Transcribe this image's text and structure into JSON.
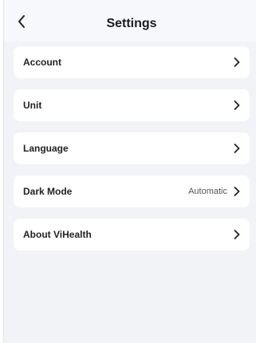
{
  "header": {
    "title": "Settings",
    "back_icon": "chevron-left-icon"
  },
  "settings": {
    "items": [
      {
        "label": "Account",
        "value": ""
      },
      {
        "label": "Unit",
        "value": ""
      },
      {
        "label": "Language",
        "value": ""
      },
      {
        "label": "Dark Mode",
        "value": "Automatic"
      },
      {
        "label": "About ViHealth",
        "value": ""
      }
    ],
    "chevron_icon": "chevron-right-icon"
  },
  "colors": {
    "background": "#f2f3f7",
    "card": "#ffffff",
    "text": "#1b1b1b"
  }
}
